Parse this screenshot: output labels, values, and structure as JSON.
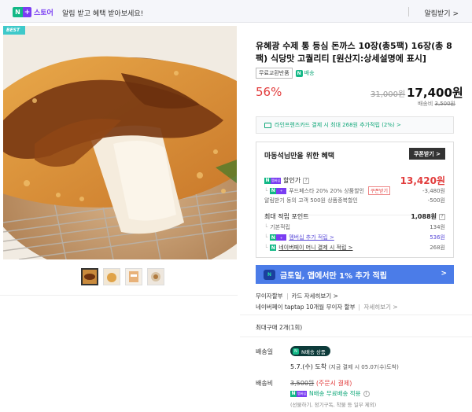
{
  "topbar": {
    "store_np": "N",
    "store_plus": "+",
    "store_label": "스토어",
    "message": "알림 받고 혜택 받아보세요!",
    "alarm_button": "알림받기 >"
  },
  "gallery": {
    "best_tag": "BEST"
  },
  "product": {
    "title": "유혜광 수제 통 등심 돈까스 10장(총5팩) 16장(총 8팩) 식당맛 고퀄리티 [원산지:상세설명에 표시]",
    "badge_return": "무료교환반품",
    "badge_pay": "배송",
    "discount": "56%",
    "original_price": "31,000원",
    "sale_price": "17,400원",
    "ship_fee_label": "배송비",
    "ship_fee_value": "3,500원"
  },
  "card_banner": {
    "text": "라인프렌즈카드 결제 시 최대 268원 추가적립 (2%) >"
  },
  "benefit": {
    "title": "마동석님만을 위한 혜택",
    "coupon_button": "쿠폰받기 >",
    "discount_label": "할인가",
    "discount_price": "13,420원",
    "row1_label": "푸드페스타 20% 20% 상품할인",
    "row1_tag": "쿠폰받기",
    "row1_value": "-3,480원",
    "row2_label": "알림받기 동의 고객 500원 상품중복할인",
    "row2_value": "-500원",
    "points_label": "최대 적립 포인트",
    "points_value": "1,088원",
    "basic_label": "기본적립",
    "basic_value": "134원",
    "member_label": "멤버십 추가 적립 >",
    "member_value": "536원",
    "money_label": "네이버페이 머니 결제 시 적립 >",
    "money_value": "268원"
  },
  "promo": {
    "text": "금토일, 앱에서만 1% 추가 적립",
    "chevron": ">"
  },
  "info": {
    "installment_label": "무이자할부",
    "installment_link": "카드 자세히보기 >",
    "taptap_label": "네이버페이 taptap 10개월 무이자 할부",
    "taptap_link": "자세히보기 >",
    "max_purchase": "최대구매 2개(1회)"
  },
  "delivery": {
    "label": "배송일",
    "tag": "N배송 상품",
    "arrival_main": "5.7.(수) 도착",
    "arrival_sub": "(지금 결제 시 05.07(수)도착)"
  },
  "shipping": {
    "label": "배송비",
    "cost": "3,500원",
    "note_red": "(주문시 결제)",
    "free_text": "N배송 무료배송 적용",
    "sub_note": "(선물하기, 정기구독, 착불 등 일부 제외)"
  },
  "icons": {
    "accent_green": "#12b886",
    "accent_purple": "#7a3df2",
    "accent_red": "#e23c3c",
    "promo_blue": "#4b7ce8"
  }
}
